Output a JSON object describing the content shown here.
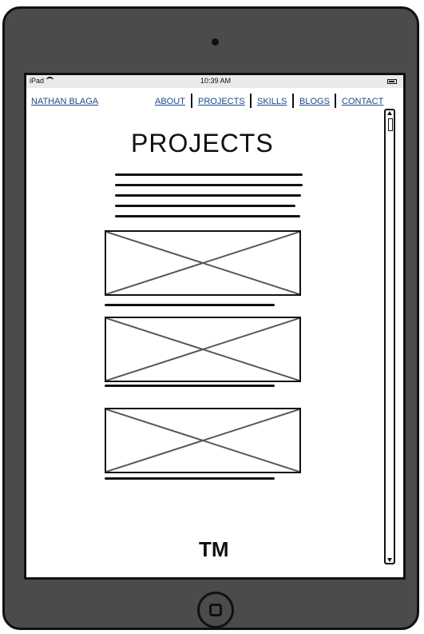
{
  "status": {
    "device": "iPad",
    "time": "10:39 AM"
  },
  "nav": {
    "brand": "NATHAN BLAGA",
    "links": [
      "ABOUT",
      "PROJECTS",
      "SKILLS",
      "BLOGS",
      "CONTACT"
    ]
  },
  "page": {
    "title": "PROJECTS",
    "footer": "TM"
  },
  "icons": {
    "wifi": "wifi-icon",
    "battery": "battery-icon",
    "camera": "camera-icon",
    "home": "home-button-icon",
    "placeholder": "image-placeholder-icon"
  },
  "colors": {
    "link": "#1a4a8a",
    "device": "#4b4b4b",
    "status_bar": "#e8eaeb"
  }
}
